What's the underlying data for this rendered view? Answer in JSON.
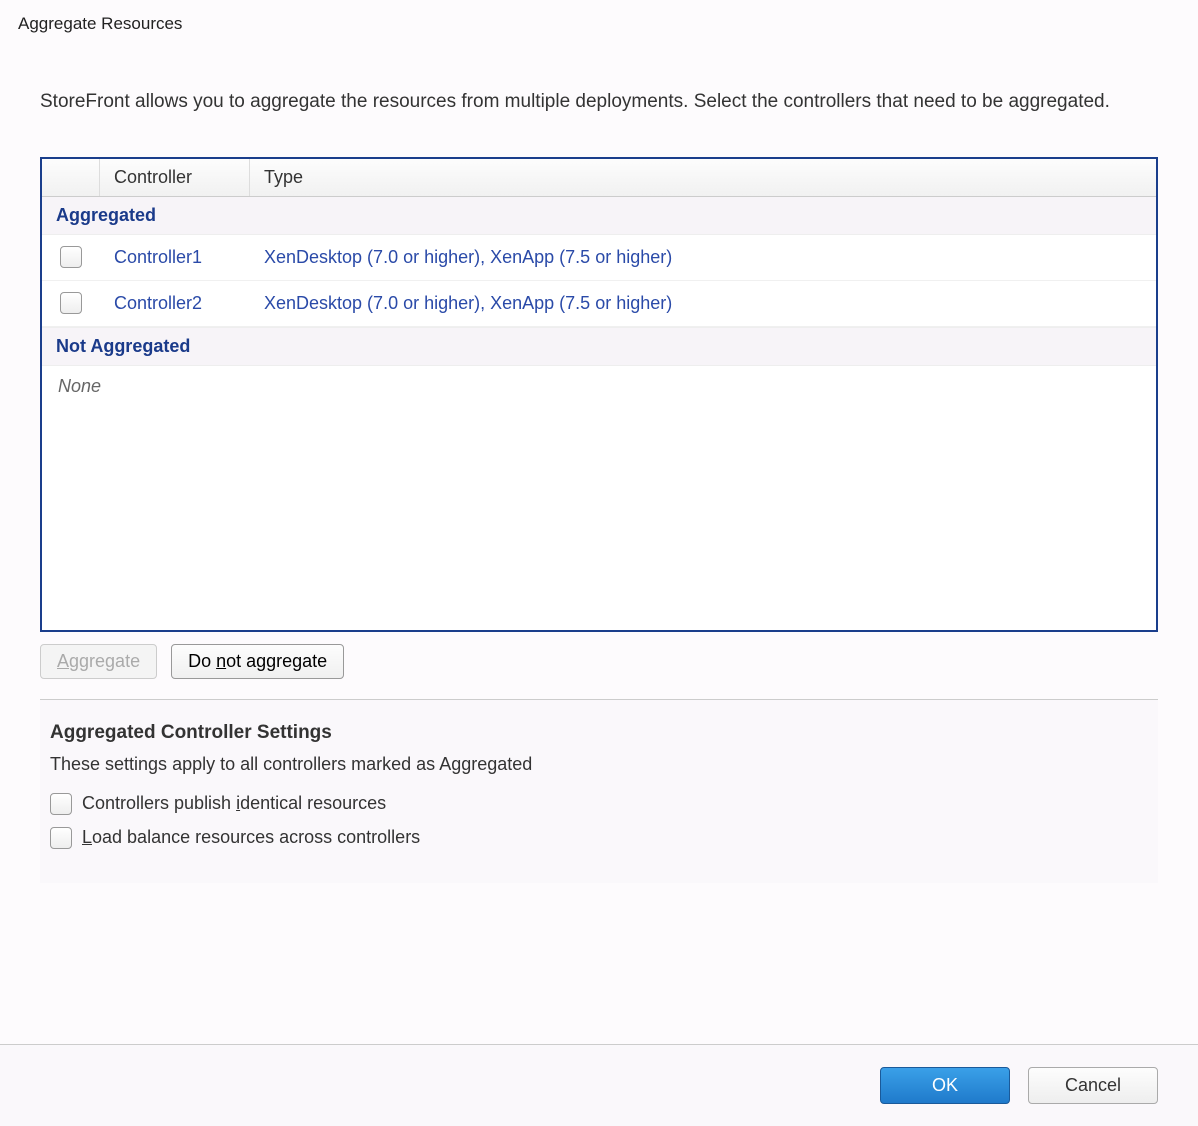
{
  "dialog": {
    "title": "Aggregate Resources",
    "description": "StoreFront allows you to aggregate the resources from multiple deployments. Select the controllers that need to be aggregated."
  },
  "table": {
    "columns": {
      "controller": "Controller",
      "type": "Type"
    },
    "groups": {
      "aggregated_label": "Aggregated",
      "not_aggregated_label": "Not Aggregated",
      "none_label": "None"
    },
    "rows": [
      {
        "controller": "Controller1",
        "type": "XenDesktop (7.0 or higher), XenApp (7.5 or higher)"
      },
      {
        "controller": "Controller2",
        "type": "XenDesktop (7.0 or higher), XenApp (7.5 or higher)"
      }
    ]
  },
  "buttons": {
    "aggregate_pre": "",
    "aggregate_key": "A",
    "aggregate_post": "ggregate",
    "do_not_aggregate_pre": "Do ",
    "do_not_aggregate_key": "n",
    "do_not_aggregate_post": "ot aggregate"
  },
  "settings": {
    "title": "Aggregated Controller Settings",
    "description": "These settings apply to all controllers marked as Aggregated",
    "identical_pre": "Controllers publish ",
    "identical_key": "i",
    "identical_post": "dentical resources",
    "load_pre": "",
    "load_key": "L",
    "load_post": "oad balance resources across controllers"
  },
  "footer": {
    "ok": "OK",
    "cancel": "Cancel"
  }
}
